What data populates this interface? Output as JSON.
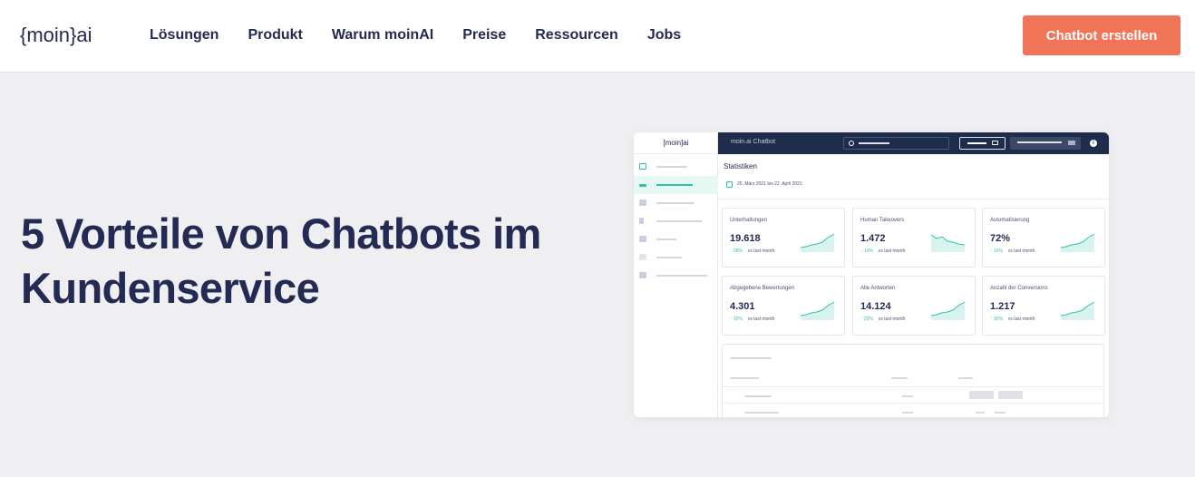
{
  "header": {
    "logo_text": "{moin}ai",
    "nav": [
      "Lösungen",
      "Produkt",
      "Warum moinAI",
      "Preise",
      "Ressourcen",
      "Jobs"
    ],
    "cta_label": "Chatbot erstellen"
  },
  "hero": {
    "title": "5 Vorteile von Chatbots im Kundenservice"
  },
  "mockup": {
    "side_logo": "[moin]ai",
    "top_title": "moin.ai Chatbot",
    "stats_title": "Statistiken",
    "date_range": "25. März 2021 bis 22. April 2021",
    "cards": [
      {
        "label": "Unterhaltungen",
        "value": "19.618",
        "delta": "↑ 28%",
        "vs": "vs last month",
        "trend": "up"
      },
      {
        "label": "Human Takeovers",
        "value": "1.472",
        "delta": "↓ 10%",
        "vs": "vs last month",
        "trend": "down"
      },
      {
        "label": "Automatisierung",
        "value": "72%",
        "delta": "↑ 10%",
        "vs": "vs last month",
        "trend": "up"
      },
      {
        "label": "Abgegebene Bewertungen",
        "value": "4.301",
        "delta": "↑ 15%",
        "vs": "vs last month",
        "trend": "up"
      },
      {
        "label": "Alle Antworten",
        "value": "14.124",
        "delta": "↑ 20%",
        "vs": "vs last month",
        "trend": "up"
      },
      {
        "label": "Anzahl der Conversions",
        "value": "1.217",
        "delta": "↑ 30%",
        "vs": "vs last month",
        "trend": "up"
      }
    ]
  },
  "colors": {
    "brand": "#232a53",
    "accent": "#f07558",
    "teal": "#2cc2a9",
    "background": "#efeef0"
  }
}
